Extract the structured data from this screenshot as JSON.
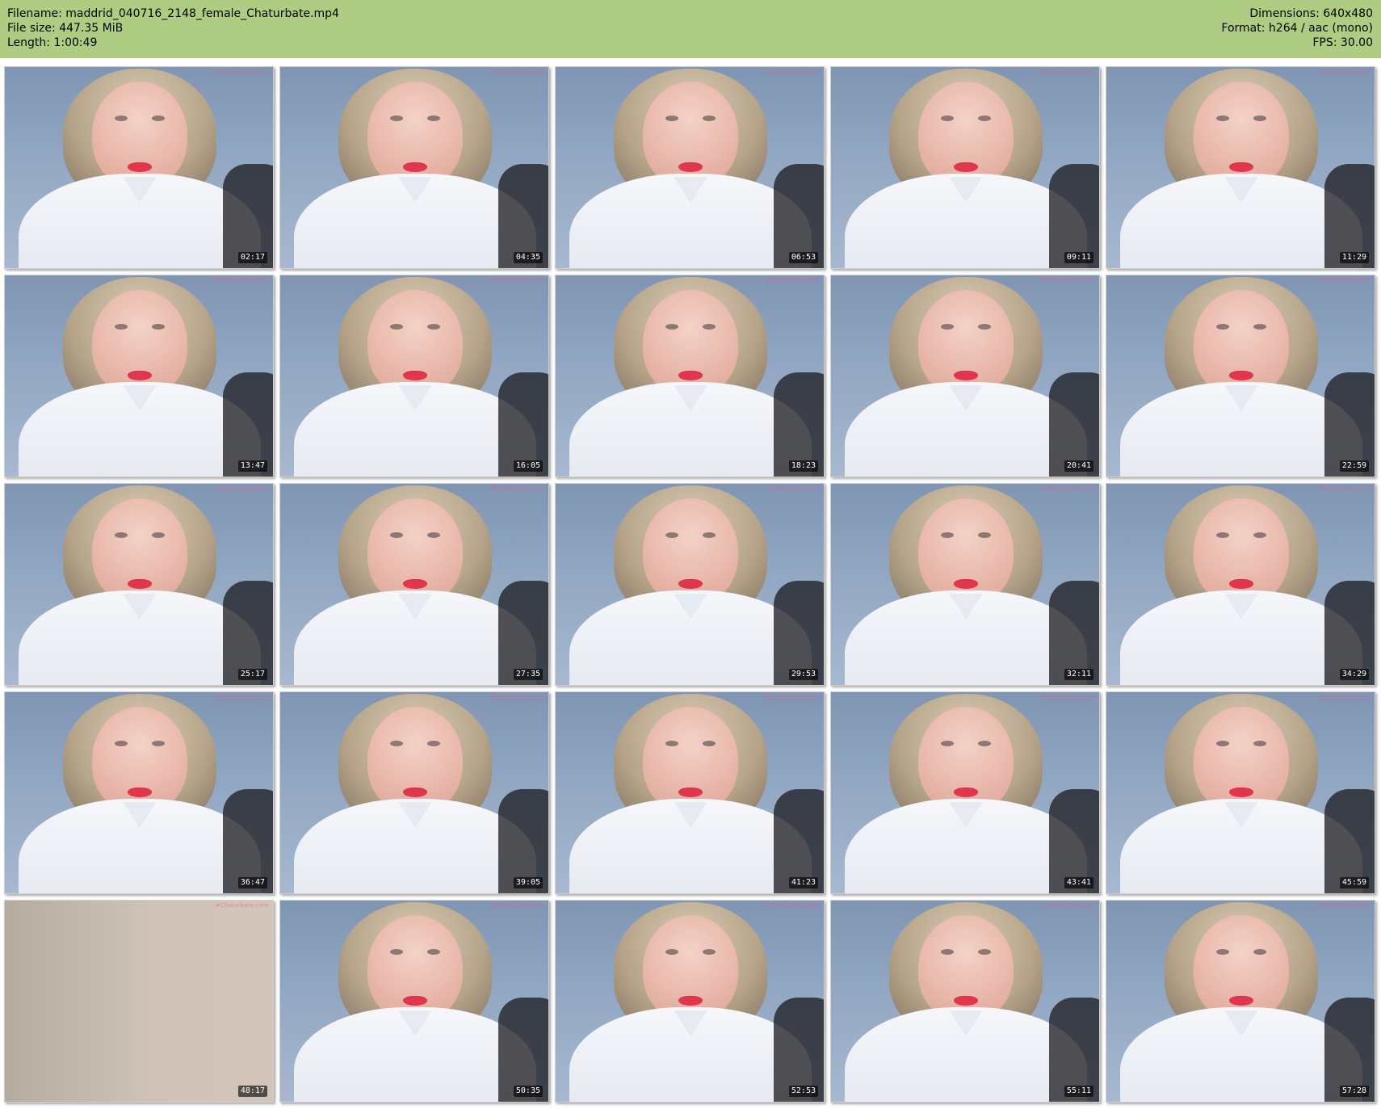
{
  "header": {
    "left_lines": [
      "Filename: maddrid_040716_2148_female_Chaturbate.mp4",
      "File size: 447.35 MiB",
      "Length: 1:00:49"
    ],
    "right_lines": [
      "Dimensions: 640x480",
      "Format: h264 / aac (mono)",
      "FPS: 30.00"
    ],
    "bg_color": "#afcd82"
  },
  "thumbnails": {
    "watermark": "#Chaturbate.com",
    "timestamps": [
      "02:17",
      "04:35",
      "06:53",
      "09:11",
      "11:29",
      "13:47",
      "16:05",
      "18:23",
      "20:41",
      "22:59",
      "25:17",
      "27:35",
      "29:53",
      "32:11",
      "34:29",
      "36:47",
      "39:05",
      "41:23",
      "43:41",
      "45:59",
      "48:17",
      "50:35",
      "52:53",
      "55:11",
      "57:28"
    ],
    "special_wall_indices": [
      20
    ]
  }
}
